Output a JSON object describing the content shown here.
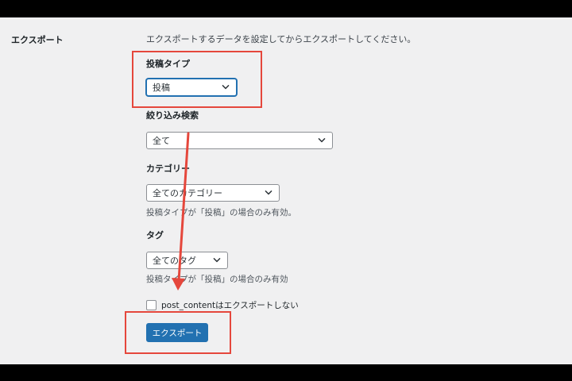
{
  "export": {
    "section_label": "エクスポート",
    "description": "エクスポートするデータを設定してからエクスポートしてください。",
    "post_type": {
      "label": "投稿タイプ",
      "selected": "投稿"
    },
    "filter": {
      "label": "絞り込み検索",
      "selected": "全て"
    },
    "category": {
      "label": "カテゴリー",
      "selected": "全てのカテゴリー",
      "help": "投稿タイプが「投稿」の場合のみ有効。"
    },
    "tag": {
      "label": "タグ",
      "selected": "全てのタグ",
      "help": "投稿タイプが「投稿」の場合のみ有効"
    },
    "checkbox_label": "post_contentはエクスポートしない",
    "submit_label": "エクスポート"
  },
  "colors": {
    "panel_bg": "#f0f0f1",
    "accent": "#2271b1",
    "annotation": "#e5473c"
  },
  "icons": {
    "select_arrow": "chevron-down-icon"
  }
}
